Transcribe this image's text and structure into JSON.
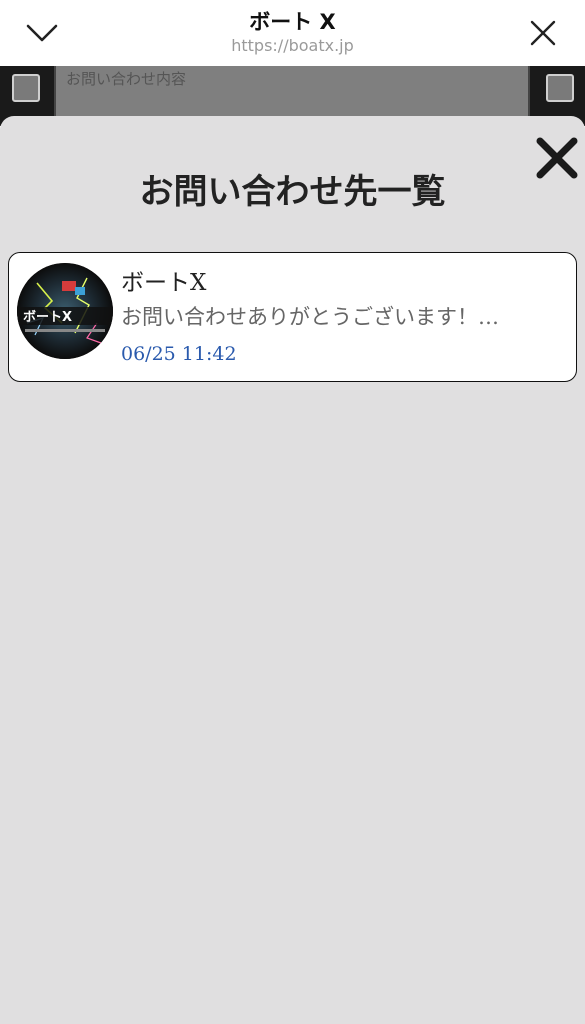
{
  "browser": {
    "title": "ボート X",
    "url": "https://boatx.jp",
    "collapse_icon": "chevron-down-icon",
    "close_icon": "close-icon"
  },
  "background_page": {
    "field_label": "お問い合わせ内容"
  },
  "modal": {
    "heading": "お問い合わせ先一覧",
    "close_icon": "close-icon",
    "items": [
      {
        "name": "ボートX",
        "message": "お問い合わせありがとうございます！…",
        "time": "06/25 11:42",
        "avatar_logo_text": "ボートX"
      }
    ]
  },
  "colors": {
    "sheet_bg": "#e0dfe0",
    "time_text": "#2a5aad"
  }
}
